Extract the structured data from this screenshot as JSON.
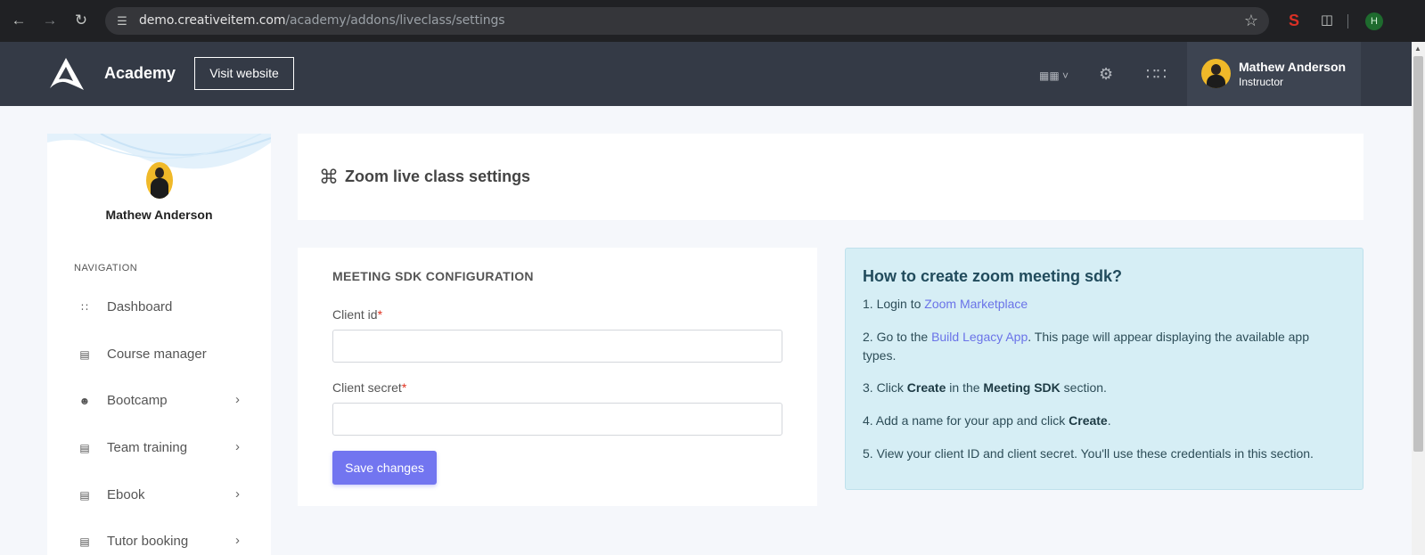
{
  "browser": {
    "url_host": "demo.creativeitem.com",
    "url_path": "/academy/addons/liveclass/settings",
    "profile_initial": "H"
  },
  "header": {
    "brand": "Academy",
    "visit_label": "Visit website",
    "user_name": "Mathew Anderson",
    "user_role": "Instructor"
  },
  "sidebar": {
    "user_name": "Mathew Anderson",
    "nav_title": "NAVIGATION",
    "items": [
      {
        "label": "Dashboard",
        "icon": "grid-icon",
        "has_children": false
      },
      {
        "label": "Course manager",
        "icon": "layers-icon",
        "has_children": false
      },
      {
        "label": "Bootcamp",
        "icon": "users-icon",
        "has_children": true
      },
      {
        "label": "Team training",
        "icon": "document-icon",
        "has_children": true
      },
      {
        "label": "Ebook",
        "icon": "document-icon",
        "has_children": true
      },
      {
        "label": "Tutor booking",
        "icon": "document-icon",
        "has_children": true
      }
    ]
  },
  "page": {
    "title": "Zoom live class settings"
  },
  "form": {
    "section_title": "MEETING SDK CONFIGURATION",
    "client_id_label": "Client id",
    "client_id_value": "",
    "client_secret_label": "Client secret",
    "client_secret_value": "",
    "required_mark": "*",
    "save_label": "Save changes"
  },
  "help": {
    "title": "How to create zoom meeting sdk?",
    "step1_text": "1. Login to ",
    "step1_link": "Zoom Marketplace",
    "step2_pre": "2. Go to the ",
    "step2_link": "Build Legacy App",
    "step2_post": ". This page will appear displaying the available app types.",
    "step3_pre": "3. Click ",
    "step3_b1": "Create",
    "step3_mid": " in the ",
    "step3_b2": "Meeting SDK",
    "step3_post": " section.",
    "step4_pre": "4. Add a name for your app and click ",
    "step4_b": "Create",
    "step4_post": ".",
    "step5_text": "5. View your client ID and client secret. You'll use these credentials in this section."
  }
}
